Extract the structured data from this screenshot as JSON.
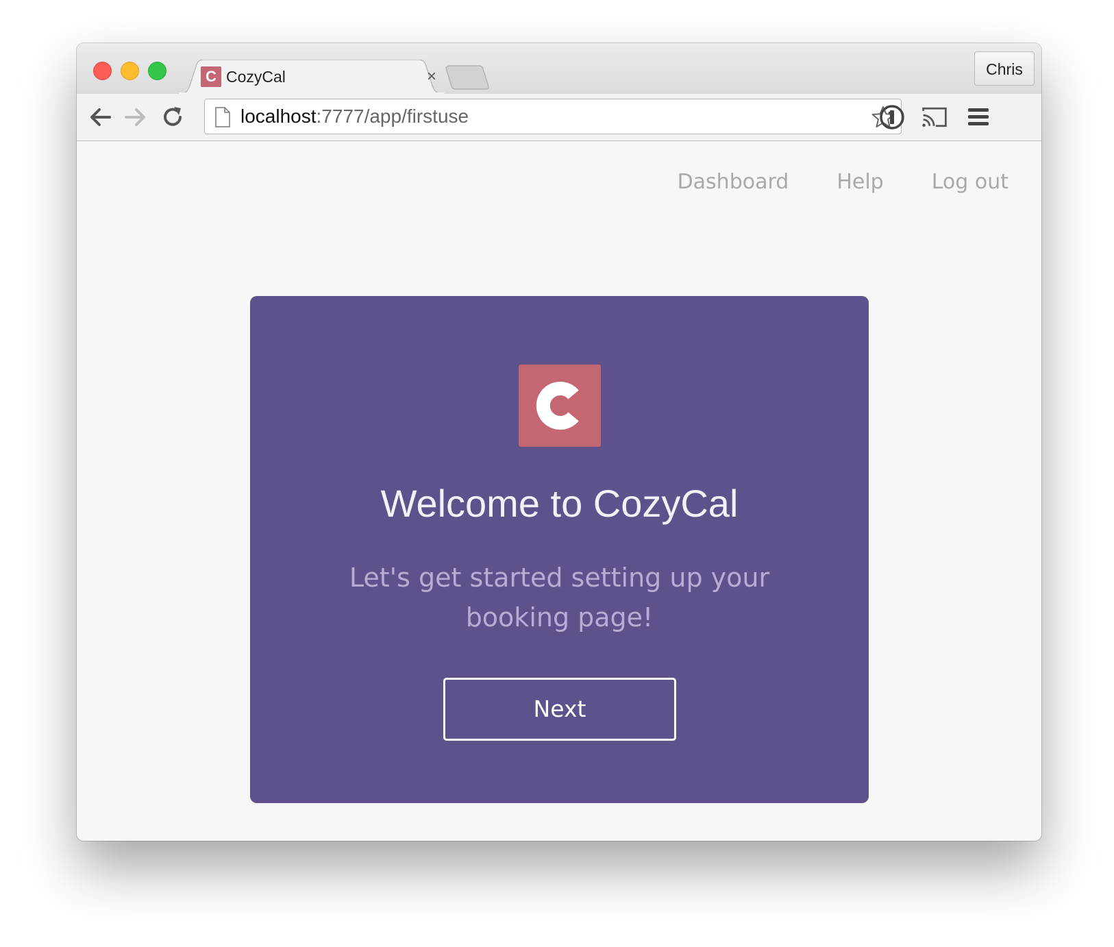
{
  "browser": {
    "tab_title": "CozyCal",
    "tab_favicon_letter": "C",
    "tab_close_glyph": "×",
    "profile_name": "Chris",
    "url_host": "localhost",
    "url_rest": ":7777/app/firstuse",
    "icons": [
      "back-icon",
      "forward-icon",
      "reload-icon",
      "page-icon",
      "star-icon",
      "1password-icon",
      "cast-icon",
      "menu-icon"
    ]
  },
  "nav": {
    "dashboard": "Dashboard",
    "help": "Help",
    "logout": "Log out"
  },
  "card": {
    "title": "Welcome to CozyCal",
    "subtitle": "Let's get started setting up your booking page!",
    "next_label": "Next",
    "background_color": "#5f518b",
    "logo_color": "#c56673"
  }
}
